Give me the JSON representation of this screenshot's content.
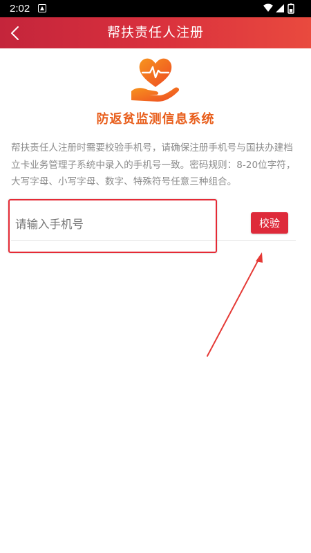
{
  "status_bar": {
    "time": "2:02",
    "icons": [
      "notification-a-icon",
      "wifi-icon",
      "cellular-signal-icon",
      "battery-icon"
    ]
  },
  "header": {
    "title": "帮扶责任人注册",
    "back_icon": "chevron-left-icon",
    "gradient_colors": [
      "#c4253b",
      "#e94a3e"
    ]
  },
  "brand": {
    "logo_icon": "heart-in-hand-icon",
    "name": "防返贫监测信息系统",
    "color": "#e85d1a"
  },
  "notice": {
    "text": "帮扶责任人注册时需要校验手机号，请确保注册手机号与国扶办建档立卡业务管理子系统中录入的手机号一致。密码规则：8-20位字符，大写字母、小写字母、数字、特殊符号任意三种组合。"
  },
  "form": {
    "phone_input": {
      "placeholder": "请输入手机号",
      "value": ""
    },
    "verify_button": "校验",
    "accent_color": "#de2a3a"
  }
}
